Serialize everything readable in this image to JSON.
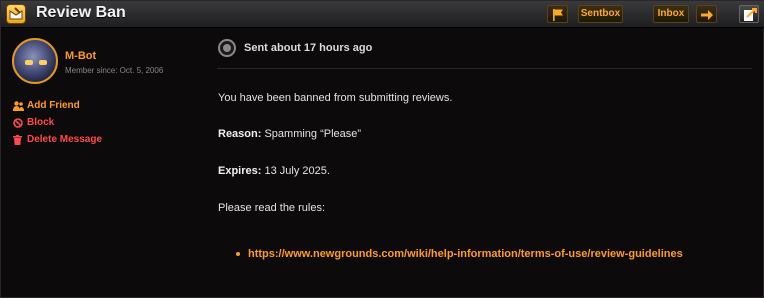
{
  "header": {
    "title": "Review Ban",
    "sentbox_label": "Sentbox",
    "inbox_label": "Inbox"
  },
  "sender": {
    "name": "M-Bot",
    "member_since": "Member since: Oct. 5, 2006"
  },
  "actions": {
    "add_friend": "Add Friend",
    "block": "Block",
    "delete_message": "Delete Message"
  },
  "message": {
    "sent": "Sent about 17 hours ago",
    "intro": "You have been banned from submitting reviews.",
    "reason_label": "Reason:",
    "reason_value": "Spamming “Please”",
    "expires_label": "Expires:",
    "expires_value": "13 July 2025.",
    "rules_prompt": "Please read the rules:",
    "rules_link": "https://www.newgrounds.com/wiki/help-information/terms-of-use/review-guidelines"
  },
  "icons": {
    "app": "mail-icon",
    "flag": "flag-icon",
    "arrow": "arrow-right-icon",
    "compose": "compose-icon",
    "add_friend": "add-user-icon",
    "block": "block-icon",
    "delete": "trash-icon",
    "sent": "radio-status-icon"
  },
  "colors": {
    "accent": "#ff9c1f",
    "danger": "#ff4a4a",
    "background": "#0d0a0c"
  }
}
